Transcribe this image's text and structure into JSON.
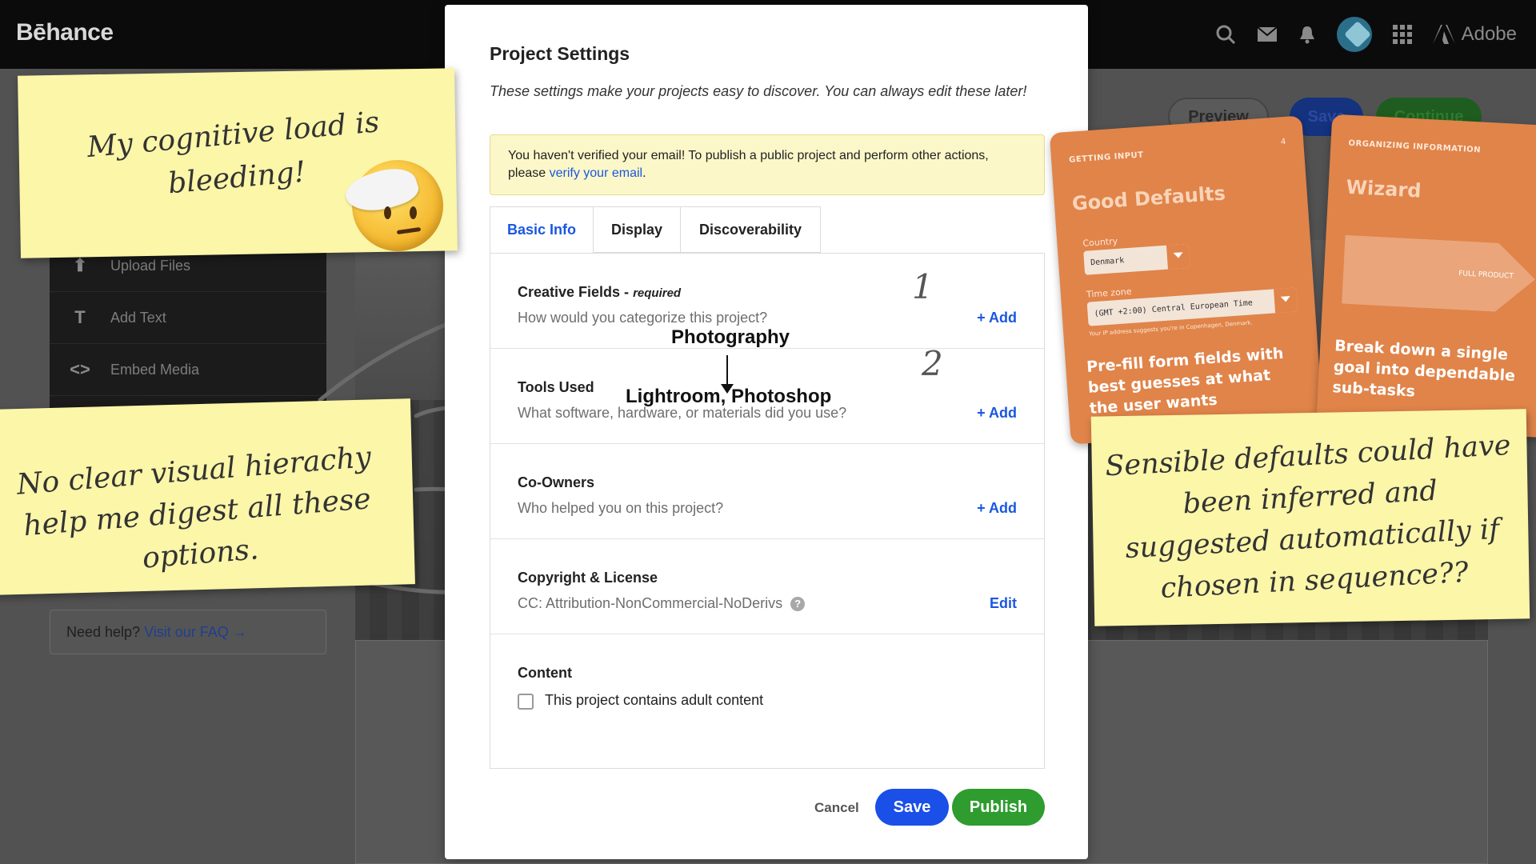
{
  "app": {
    "logo": "Bēhance",
    "brand": "Adobe"
  },
  "header": {
    "preview_label": "Preview",
    "save_label": "Save",
    "continue_label": "Continue"
  },
  "sidebar": {
    "items": [
      {
        "icon": "upload-icon",
        "label": "Upload Files"
      },
      {
        "icon": "text-icon",
        "label": "Add Text"
      },
      {
        "icon": "embed-icon",
        "label": "Embed Media"
      }
    ],
    "help_text": "Need help?",
    "help_link": "Visit our FAQ →"
  },
  "modal": {
    "title": "Project Settings",
    "subtitle": "These settings make your projects easy to discover. You can always edit these later!",
    "alert_text": "You haven't verified your email! To publish a public project and perform other actions, please",
    "alert_link": "verify your email",
    "alert_end": ".",
    "tabs": [
      {
        "label": "Basic Info",
        "active": true
      },
      {
        "label": "Display",
        "active": false
      },
      {
        "label": "Discoverability",
        "active": false
      }
    ],
    "sections": [
      {
        "title": "Creative Fields - ",
        "required": "required",
        "desc": "How would you categorize this project?",
        "action": "+ Add"
      },
      {
        "title": "Tools Used",
        "desc": "What software, hardware, or materials did you use?",
        "action": "+ Add"
      },
      {
        "title": "Co-Owners",
        "desc": "Who helped you on this project?",
        "action": "+ Add"
      },
      {
        "title": "Copyright & License",
        "desc": "CC: Attribution-NonCommercial-NoDerivs",
        "action": "Edit"
      },
      {
        "title": "Content",
        "checkbox_label": "This project contains adult content",
        "checked": false
      }
    ],
    "cancel_label": "Cancel",
    "save_label": "Save",
    "publish_label": "Publish"
  },
  "annotations": {
    "photography": "Photography",
    "tools": "Lightroom, Photoshop",
    "num1": "1",
    "num2": "2",
    "note1": "My cognitive load is bleeding!",
    "note2": "No clear visual hierachy help me digest all these options.",
    "note3": "Sensible defaults could have been inferred and suggested automatically if chosen in sequence??"
  },
  "cards": {
    "card1": {
      "kicker": "GETTING INPUT",
      "num": "4",
      "title": "Good Defaults",
      "country_label": "Country",
      "country_value": "Denmark",
      "tz_label": "Time zone",
      "tz_value": "(GMT +2:00) Central European Time",
      "tz_hint": "Your IP address suggests you're in Copenhagen, Denmark.",
      "body": "Pre-fill form fields with best guesses at what the user wants"
    },
    "card2": {
      "kicker": "ORGANIZING INFORMATION",
      "title": "Wizard",
      "diagram_label": "FULL PRODUCT",
      "body": "Break down a single goal into dependable sub-tasks"
    }
  },
  "colors": {
    "accent": "#1a57e0",
    "publish": "#2e9c2e",
    "note": "#fbf6a8",
    "card": "#e0844a"
  }
}
